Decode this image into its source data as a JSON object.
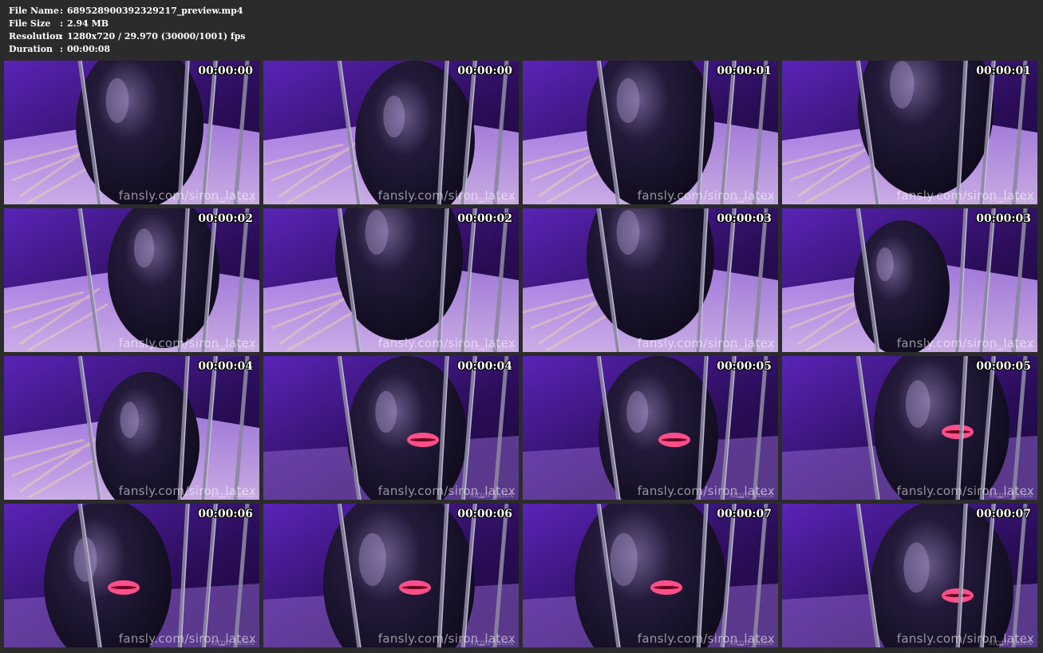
{
  "info": {
    "rows": [
      {
        "label": "File Name",
        "sep": ":",
        "value": "689528900392329217_preview.mp4"
      },
      {
        "label": "File Size",
        "sep": ":",
        "value": "2.94 MB"
      },
      {
        "label": "Resolution",
        "sep": ":",
        "value": "1280x720 / 29.970 (30000/1001) fps"
      },
      {
        "label": "Duration",
        "sep": ":",
        "value": "00:00:08"
      }
    ]
  },
  "watermark": "fansly.com/siron_latex",
  "watermark_small": "siron_latex",
  "thumbnails": [
    {
      "timestamp": "00:00:00"
    },
    {
      "timestamp": "00:00:00"
    },
    {
      "timestamp": "00:00:01"
    },
    {
      "timestamp": "00:00:01"
    },
    {
      "timestamp": "00:00:02"
    },
    {
      "timestamp": "00:00:02"
    },
    {
      "timestamp": "00:00:03"
    },
    {
      "timestamp": "00:00:03"
    },
    {
      "timestamp": "00:00:04"
    },
    {
      "timestamp": "00:00:04"
    },
    {
      "timestamp": "00:00:05"
    },
    {
      "timestamp": "00:00:05"
    },
    {
      "timestamp": "00:00:06"
    },
    {
      "timestamp": "00:00:06"
    },
    {
      "timestamp": "00:00:07"
    },
    {
      "timestamp": "00:00:07"
    }
  ],
  "colors": {
    "background": "#2b2b2b",
    "purple_dark": "#2a0d57",
    "purple_mid": "#5a24b8",
    "purple_light": "#b58af0",
    "latex_black": "#0e0a1a",
    "lips_pink": "#ff4f8a",
    "bars_gray": "#8a86a0"
  }
}
